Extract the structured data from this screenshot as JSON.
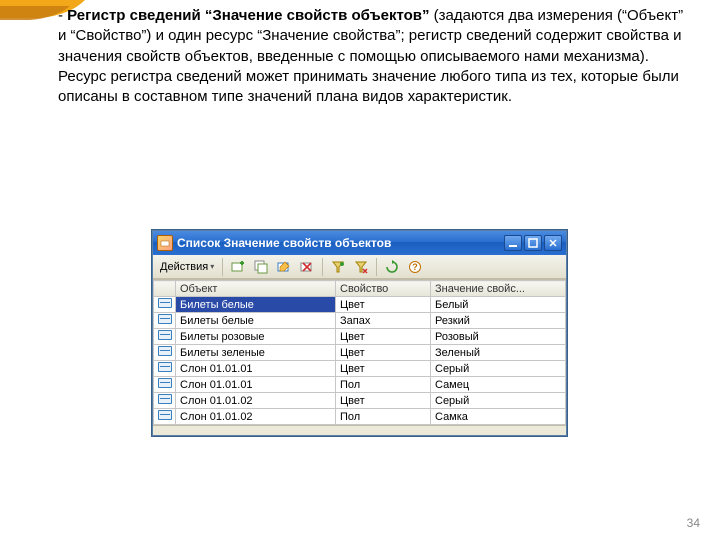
{
  "paragraph": {
    "dash": "- ",
    "bold": "Регистр сведений “Значение свойств объектов”",
    "rest": " (задаются два измерения (“Объект” и “Свойство”) и один ресурс “Значение свойства”; регистр сведений содержит свойства и значения свойств объектов, введенные с помощью описываемого нами механизма). Ресурс регистра сведений может принимать значение любого типа из тех, которые были описаны в составном типе значений плана видов характеристик."
  },
  "page_number": "34",
  "window": {
    "title": "Список  Значение свойств объектов",
    "actions_label": "Действия",
    "columns": {
      "object": "Объект",
      "property": "Свойство",
      "value": "Значение свойс..."
    },
    "rows": [
      {
        "object": "Билеты белые",
        "property": "Цвет",
        "value": "Белый",
        "selected": true
      },
      {
        "object": "Билеты белые",
        "property": "Запах",
        "value": "Резкий",
        "selected": false
      },
      {
        "object": "Билеты розовые",
        "property": "Цвет",
        "value": "Розовый",
        "selected": false
      },
      {
        "object": "Билеты зеленые",
        "property": "Цвет",
        "value": "Зеленый",
        "selected": false
      },
      {
        "object": "Слон 01.01.01",
        "property": "Цвет",
        "value": "Серый",
        "selected": false
      },
      {
        "object": "Слон 01.01.01",
        "property": "Пол",
        "value": "Самец",
        "selected": false
      },
      {
        "object": "Слон 01.01.02",
        "property": "Цвет",
        "value": "Серый",
        "selected": false
      },
      {
        "object": "Слон 01.01.02",
        "property": "Пол",
        "value": "Самка",
        "selected": false
      }
    ]
  }
}
